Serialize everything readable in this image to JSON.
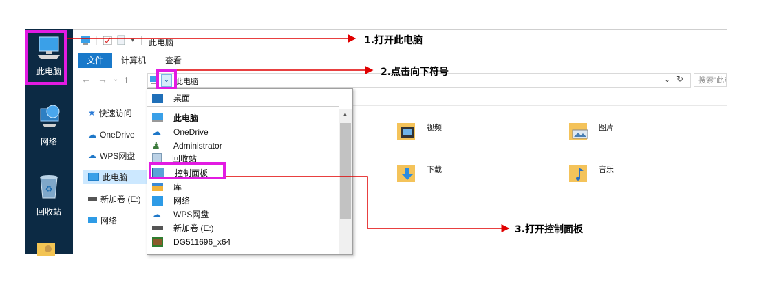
{
  "desktop": {
    "icons": [
      {
        "label": "此电脑",
        "icon": "computer-icon"
      },
      {
        "label": "网络",
        "icon": "network-globe-icon"
      },
      {
        "label": "回收站",
        "icon": "recycle-bin-icon"
      },
      {
        "label": "",
        "icon": "user-folder-icon"
      }
    ]
  },
  "explorer": {
    "title": "此电脑",
    "ribbon_tabs": [
      "文件",
      "计算机",
      "查看"
    ],
    "address": "此电脑",
    "search_placeholder": "搜索\"此电",
    "nav_items": [
      {
        "label": "快速访问",
        "icon": "star-icon"
      },
      {
        "label": "OneDrive",
        "icon": "cloud-icon"
      },
      {
        "label": "WPS网盘",
        "icon": "wps-cloud-icon"
      },
      {
        "label": "此电脑",
        "icon": "computer-icon",
        "selected": true
      },
      {
        "label": "新加卷 (E:)",
        "icon": "drive-icon"
      },
      {
        "label": "网络",
        "icon": "network-icon"
      }
    ],
    "folders": [
      {
        "label": "视频",
        "icon": "video-folder-icon"
      },
      {
        "label": "图片",
        "icon": "pictures-folder-icon"
      },
      {
        "label": "下载",
        "icon": "downloads-folder-icon"
      },
      {
        "label": "音乐",
        "icon": "music-folder-icon"
      }
    ],
    "dropdown_items": [
      {
        "label": "桌面",
        "icon": "desktop-icon"
      },
      {
        "label": "此电脑",
        "icon": "computer-icon",
        "bold": true
      },
      {
        "label": "OneDrive",
        "icon": "cloud-icon"
      },
      {
        "label": "Administrator",
        "icon": "user-icon"
      },
      {
        "label": "回收站",
        "icon": "recycle-bin-icon"
      },
      {
        "label": "控制面板",
        "icon": "control-panel-icon"
      },
      {
        "label": "库",
        "icon": "library-icon"
      },
      {
        "label": "网络",
        "icon": "network-icon"
      },
      {
        "label": "WPS网盘",
        "icon": "wps-cloud-icon"
      },
      {
        "label": "新加卷 (E:)",
        "icon": "drive-icon"
      },
      {
        "label": "DG511696_x64",
        "icon": "archive-icon"
      }
    ]
  },
  "annotations": {
    "step1": "1.打开此电脑",
    "step2": "2.点击向下符号",
    "step3": "3.打开控制面板"
  },
  "colors": {
    "highlight": "#e21be2",
    "arrow": "#e00000",
    "accent": "#1979ca",
    "desktop_bg": "#0c2a44"
  }
}
